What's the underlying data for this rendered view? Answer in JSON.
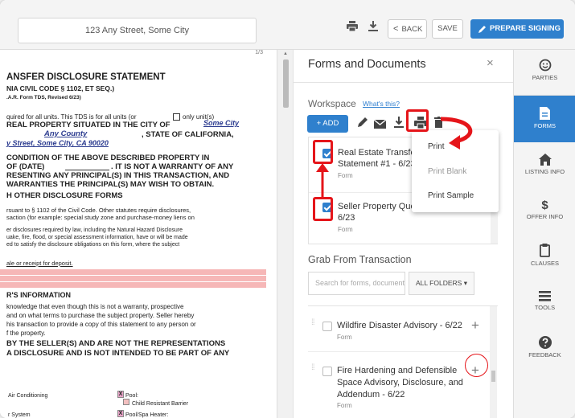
{
  "topbar": {
    "address": "123 Any Street, Some City",
    "back_label": "BACK",
    "save_label": "SAVE",
    "prepare_label": "PREPARE SIGNING"
  },
  "document": {
    "page_indicator": "1/3",
    "lines": [
      "ANSFER DISCLOSURE STATEMENT",
      "NIA CIVIL CODE § 1102, ET SEQ.)",
      ".A.R. Form TDS, Revised 6/23)",
      "quired for all units. This TDS is for all units (or",
      "only unit(s)",
      "REAL PROPERTY SITUATED IN THE CITY OF",
      "Some City",
      "Any County",
      ", STATE OF CALIFORNIA,",
      "y Street, Some City, CA  90020",
      "CONDITION OF THE ABOVE DESCRIBED PROPERTY IN",
      "OF (DATE)",
      ". IT IS NOT A WARRANTY OF ANY",
      "RESENTING ANY PRINCIPAL(S) IN THIS TRANSACTION, AND",
      "WARRANTIES THE PRINCIPAL(S) MAY WISH TO OBTAIN.",
      "H OTHER DISCLOSURE FORMS",
      "rsuant to § 1102 of the Civil Code. Other statutes require disclosures,",
      "saction (for example: special study zone and purchase-money liens on",
      "er disclosures required by law, including the Natural Hazard Disclosure",
      "uake, fire, flood, or special assessment information, have or will be made",
      "ed to satisfy the disclosure obligations on this form, where the subject",
      "ale or receipt for deposit.",
      "R'S INFORMATION",
      "knowledge that even though this is not a warranty, prospective",
      "and on what terms to purchase the subject property. Seller hereby",
      "his transaction to provide a copy of this statement to any person or",
      "f the property.",
      "BY THE SELLER(S) AND ARE NOT THE REPRESENTATIONS",
      "A DISCLOSURE AND IS NOT INTENDED TO BE PART OF ANY",
      "Air Conditioning",
      "Pool:",
      "Child Resistant Barrier",
      "r System",
      "Pool/Spa Heater:"
    ],
    "checkbox_mark": "X"
  },
  "panel": {
    "title": "Forms and Documents",
    "close": "×",
    "workspace_label": "Workspace",
    "whats_this": "What's this?",
    "add_label": "+ ADD",
    "workspace_items": [
      {
        "title_line1": "Real Estate Transfer",
        "title_line2": "Statement #1 - 6/23",
        "sub": "Form",
        "checked": true
      },
      {
        "title_line1": "Seller Property Questionnaire #1 -",
        "title_line2": "6/23",
        "sub": "Form",
        "checked": true
      }
    ],
    "grab_label": "Grab From Transaction",
    "search_placeholder": "Search for forms, documents",
    "folders_label": "ALL FOLDERS ▾",
    "grab_items": [
      {
        "title_line1": "Wildfire Disaster Advisory - 6/22",
        "sub": "Form"
      },
      {
        "title_line1": "Fire Hardening and Defensible",
        "title_line2": "Space Advisory, Disclosure, and",
        "title_line3": "Addendum - 6/22",
        "sub": "Form"
      }
    ],
    "plus": "+"
  },
  "print_menu": {
    "items": [
      "Print",
      "Print Blank",
      "Print Sample"
    ]
  },
  "rail": {
    "items": [
      "PARTIES",
      "FORMS",
      "LISTING INFO",
      "OFFER INFO",
      "CLAUSES",
      "TOOLS",
      "FEEDBACK"
    ],
    "active": "FORMS"
  },
  "colors": {
    "accent": "#2f80cd",
    "annotation_red": "#e5151a",
    "highlight_pink": "#f6b7b7"
  }
}
